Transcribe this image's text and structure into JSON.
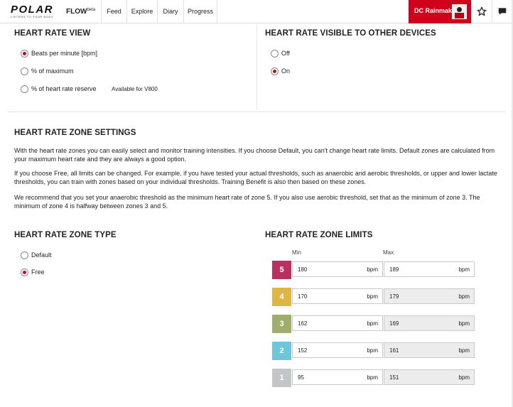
{
  "nav": {
    "logo": "POLAR",
    "logo_tagline": "LISTENS TO YOUR BODY",
    "app_name": "FLOW",
    "app_badge": "beta",
    "items": [
      "Feed",
      "Explore",
      "Diary",
      "Progress"
    ],
    "user_name": "DC Rainmaker",
    "icons": [
      "star-icon",
      "chat-bubble-icon"
    ]
  },
  "heart_rate_view": {
    "title": "HEART RATE VIEW",
    "options": [
      "Beats per minute [bpm]",
      "% of maximum",
      "% of heart rate reserve"
    ],
    "selected": "Beats per minute [bpm]",
    "reserve_note": "Available for V800"
  },
  "visibility": {
    "title": "HEART RATE VISIBLE TO OTHER DEVICES",
    "options": [
      "Off",
      "On"
    ],
    "selected": "On"
  },
  "zone_settings": {
    "title": "HEART RATE ZONE SETTINGS",
    "paragraphs": [
      "With the heart rate zones you can easily select and monitor training intensities. If you choose Default, you can't change heart rate limits. Default zones are calculated from your maximum heart rate and they are always a good option.",
      "If you choose Free, all limits can be changed. For example, if you have tested your actual thresholds, such as anaerobic and aerobic thresholds, or upper and lower lactate thresholds, you can train with zones based on your individual thresholds. Training Benefit is also then based on these zones.",
      "We recommend that you set your anaerobic threshold as the minimum heart rate of zone 5. If you also use aerobic threshold, set that as the minimum of zone 3. The minimum of zone 4 is halfway between zones 3 and 5."
    ]
  },
  "zone_type": {
    "title": "HEART RATE ZONE TYPE",
    "options": [
      "Default",
      "Free"
    ],
    "selected": "Free"
  },
  "zone_limits": {
    "title": "HEART RATE ZONE LIMITS",
    "min_label": "Min",
    "max_label": "Max",
    "unit": "bpm",
    "zones": [
      {
        "zone": "5",
        "min": "180",
        "max": "189",
        "color": "#b9305f",
        "max_editable": true
      },
      {
        "zone": "4",
        "min": "170",
        "max": "179",
        "color": "#dfb644",
        "max_editable": false
      },
      {
        "zone": "3",
        "min": "162",
        "max": "169",
        "color": "#9fae6b",
        "max_editable": false
      },
      {
        "zone": "2",
        "min": "152",
        "max": "161",
        "color": "#6ec6da",
        "max_editable": false
      },
      {
        "zone": "1",
        "min": "95",
        "max": "151",
        "color": "#c3c6c6",
        "max_editable": false
      }
    ]
  },
  "colors": {
    "brand_red": "#d0021b"
  }
}
